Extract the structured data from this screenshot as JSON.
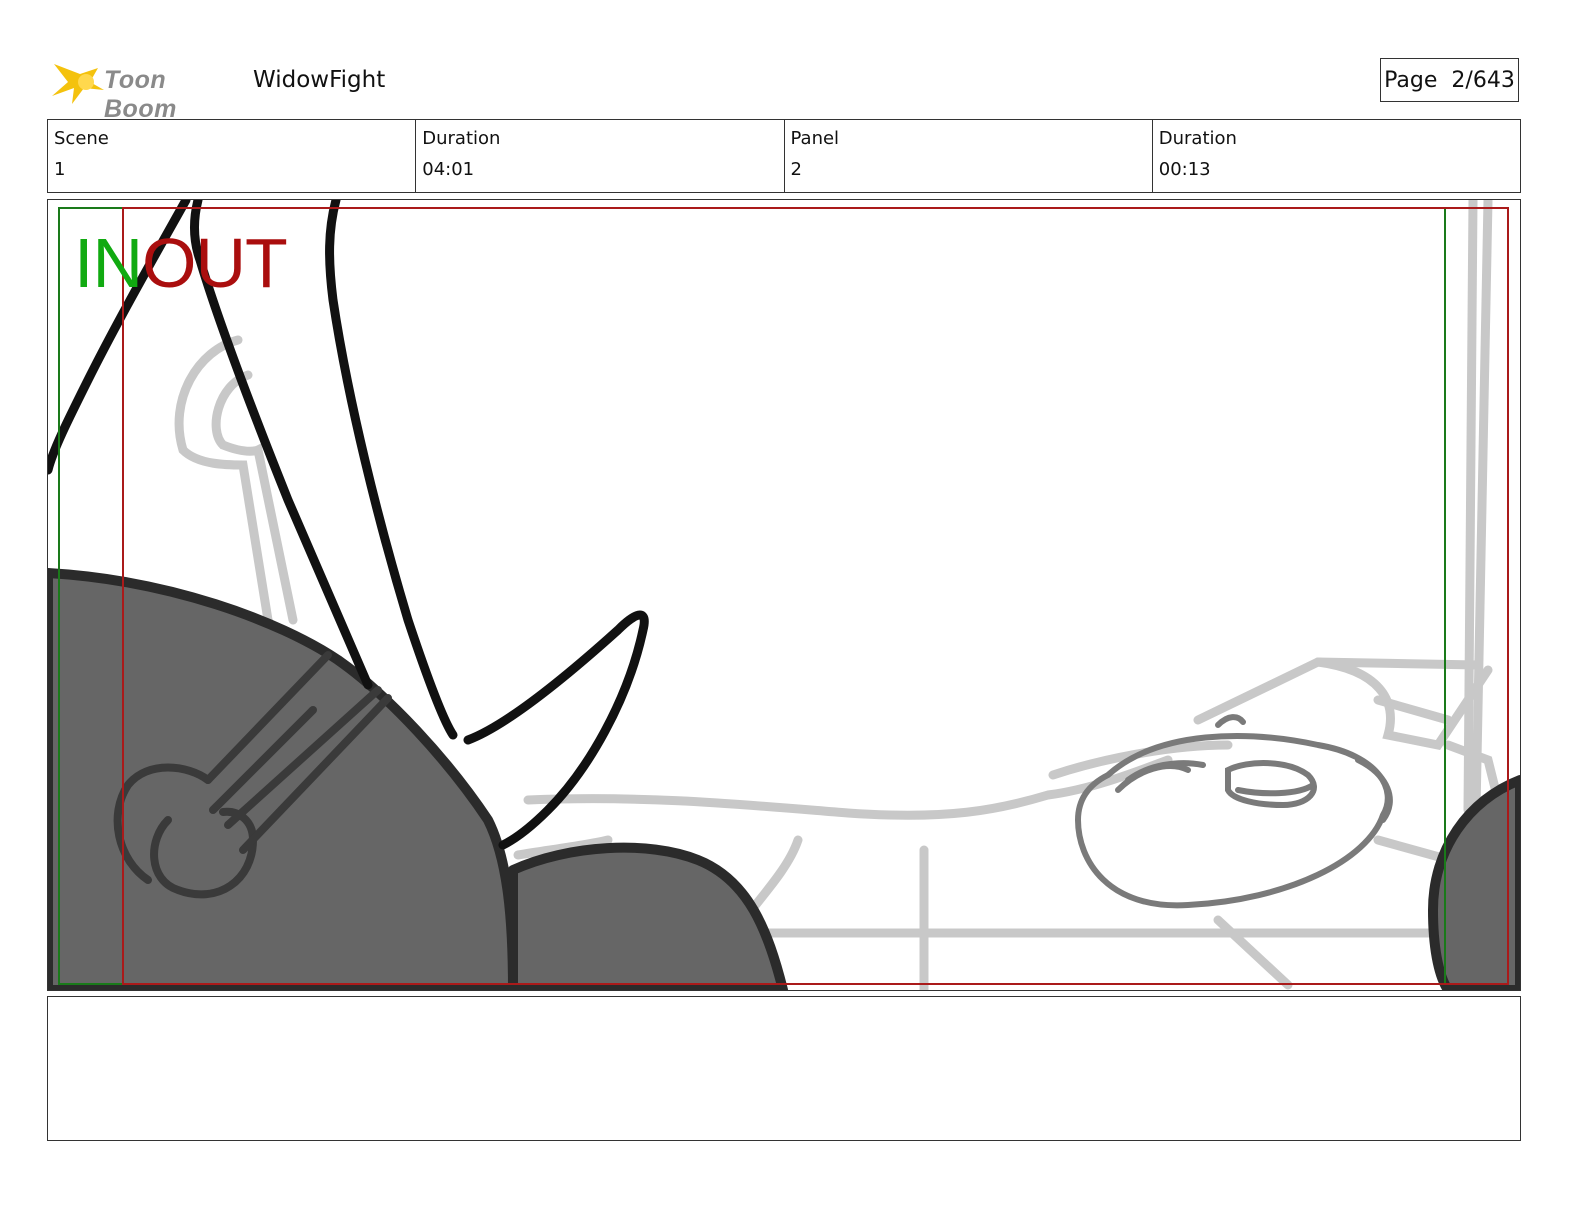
{
  "header": {
    "logo_text": "Toon Boom",
    "project_title": "WidowFight",
    "page_label": "Page",
    "page_value": "2/643"
  },
  "info": {
    "scene_label": "Scene",
    "scene_value": "1",
    "scene_duration_label": "Duration",
    "scene_duration_value": "04:01",
    "panel_label": "Panel",
    "panel_value": "2",
    "panel_duration_label": "Duration",
    "panel_duration_value": "00:13"
  },
  "panel": {
    "in_label": "IN",
    "out_label": "OUT",
    "colors": {
      "in_frame": "#1a7a1a",
      "out_frame": "#aa1a1a",
      "sketch_dark": "#111111",
      "sketch_fill": "#666666",
      "sketch_light": "#c8c8c8"
    }
  },
  "notes": {
    "text": ""
  }
}
